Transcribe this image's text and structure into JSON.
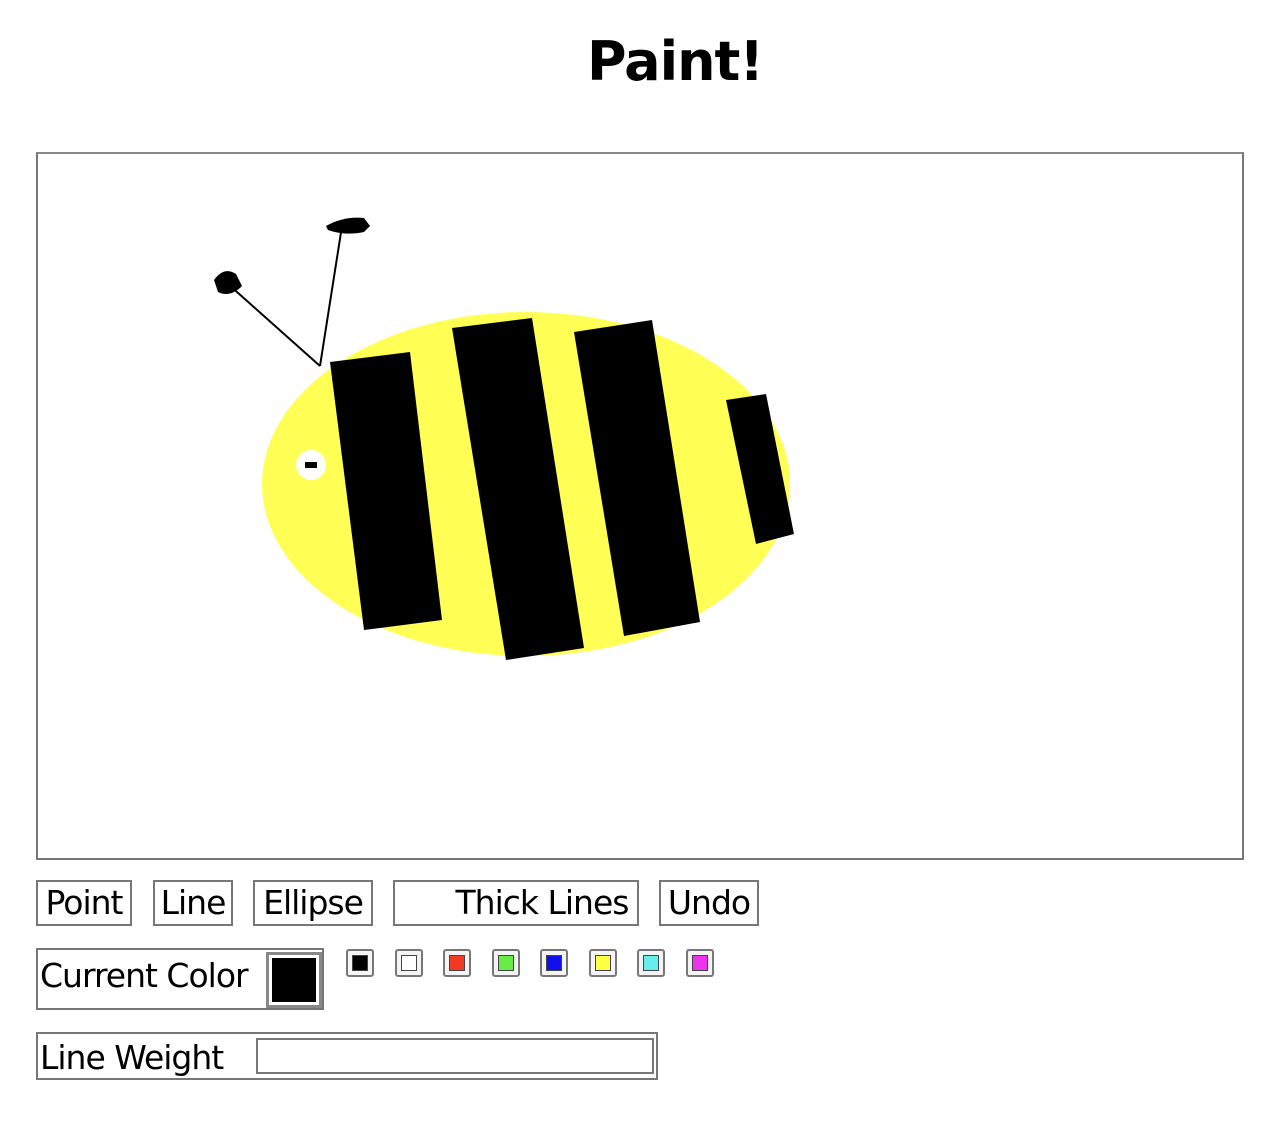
{
  "page": {
    "title": "Paint!"
  },
  "toolbar": {
    "point_label": "Point",
    "line_label": "Line",
    "ellipse_label": "Ellipse",
    "thick_lines_label": "Thick Lines",
    "undo_label": "Undo"
  },
  "current_color": {
    "label": "Current Color",
    "value": "#000000"
  },
  "palette": [
    {
      "name": "black",
      "color": "#000000"
    },
    {
      "name": "white",
      "color": "#ffffff"
    },
    {
      "name": "red",
      "color": "#ef3b24"
    },
    {
      "name": "green",
      "color": "#66ee44"
    },
    {
      "name": "blue",
      "color": "#1010ee"
    },
    {
      "name": "yellow",
      "color": "#ffff44"
    },
    {
      "name": "cyan",
      "color": "#66eeee"
    },
    {
      "name": "magenta",
      "color": "#ee33ee"
    }
  ],
  "line_weight": {
    "label": "Line Weight",
    "value": "",
    "placeholder": ""
  },
  "drawing": {
    "body_color": "#ffff55",
    "stripe_color": "#000000",
    "eye_color": "#ffffff",
    "antenna_color": "#000000"
  }
}
